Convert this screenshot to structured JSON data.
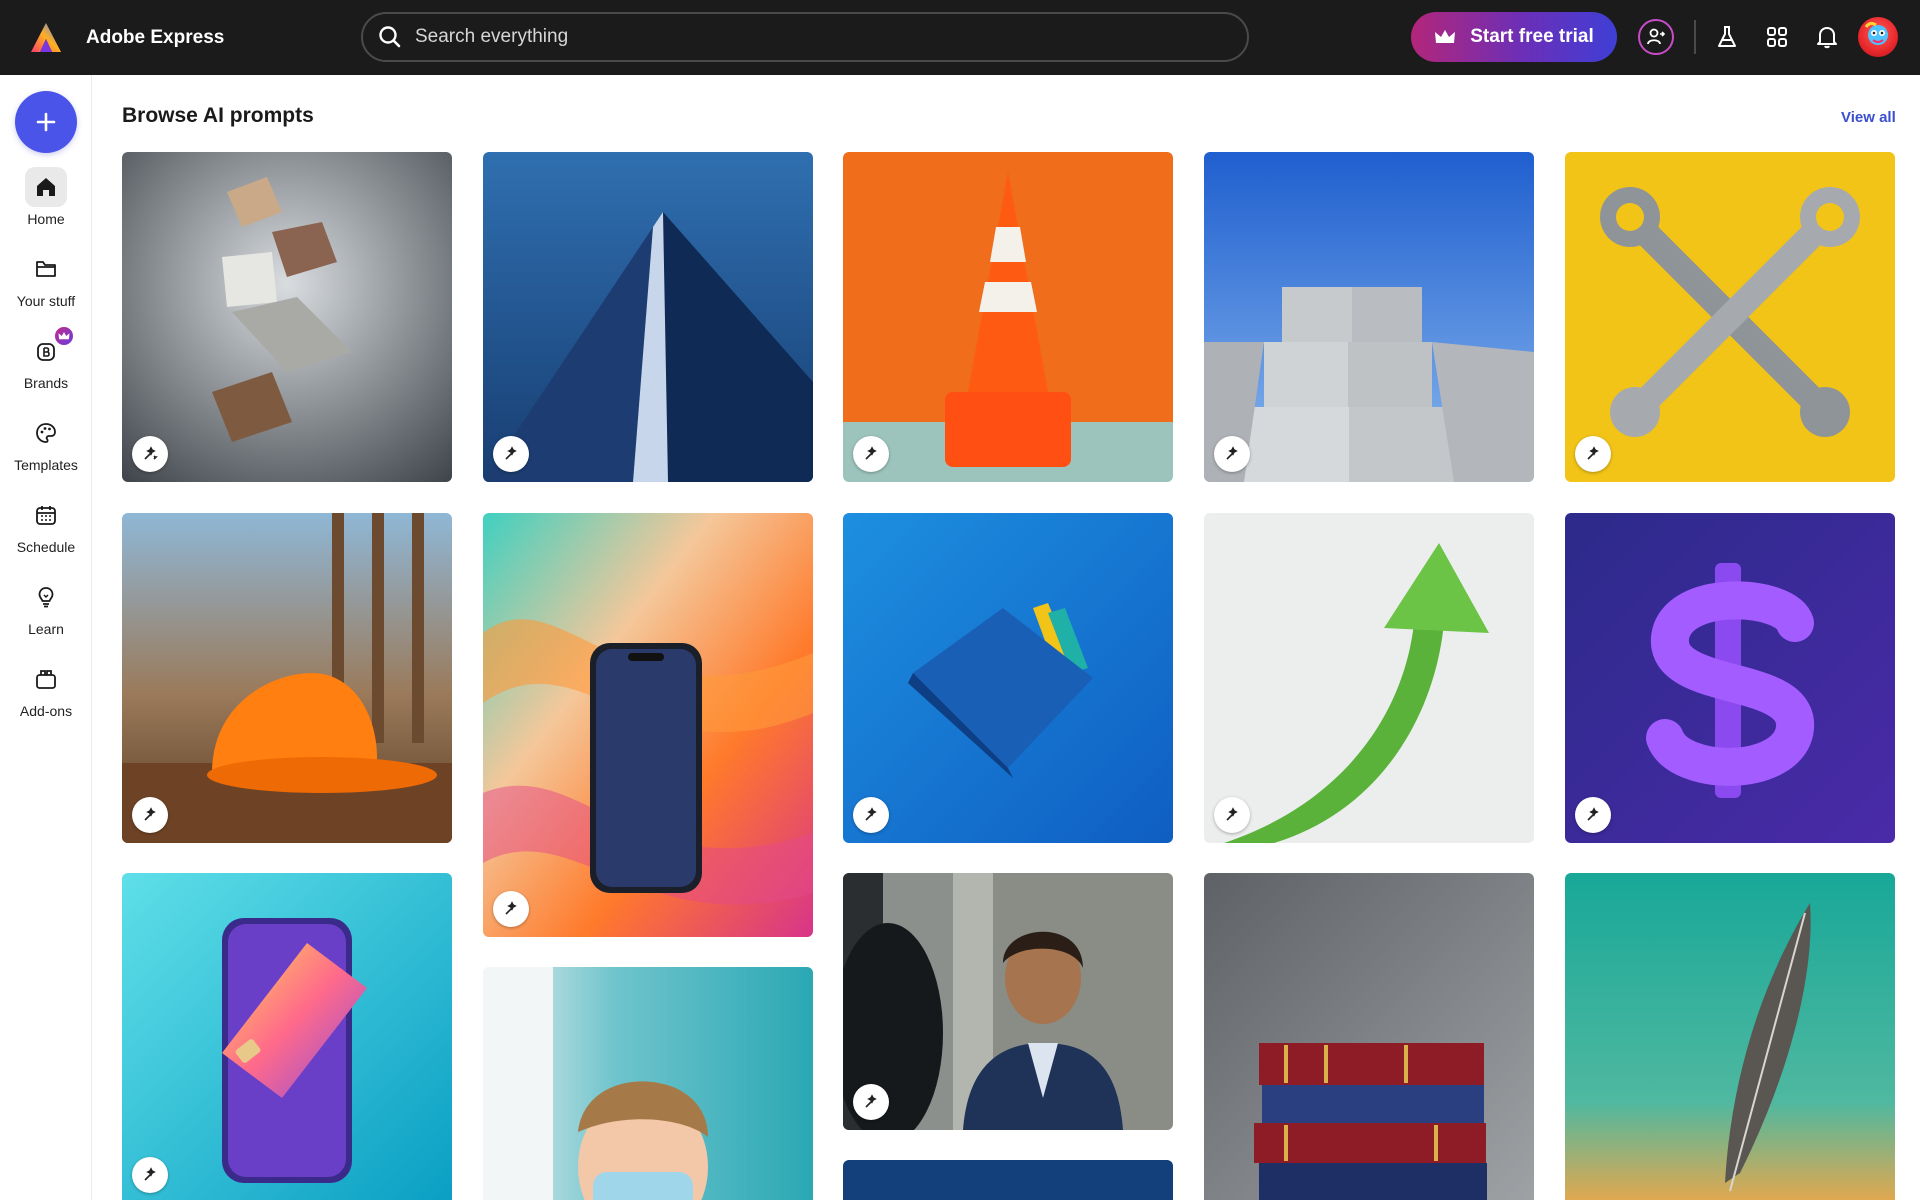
{
  "app": {
    "title": "Adobe Express"
  },
  "search": {
    "placeholder": "Search everything"
  },
  "header": {
    "trial_label": "Start free trial"
  },
  "sidebar": {
    "items": [
      {
        "label": "Home"
      },
      {
        "label": "Your stuff"
      },
      {
        "label": "Brands"
      },
      {
        "label": "Templates"
      },
      {
        "label": "Schedule"
      },
      {
        "label": "Learn"
      },
      {
        "label": "Add-ons"
      }
    ]
  },
  "main": {
    "section_title": "Browse AI prompts",
    "view_all_label": "View all"
  },
  "colors": {
    "accent": "#4b54e8",
    "topbar": "#1b1b1b",
    "link": "#3a4fcf"
  }
}
